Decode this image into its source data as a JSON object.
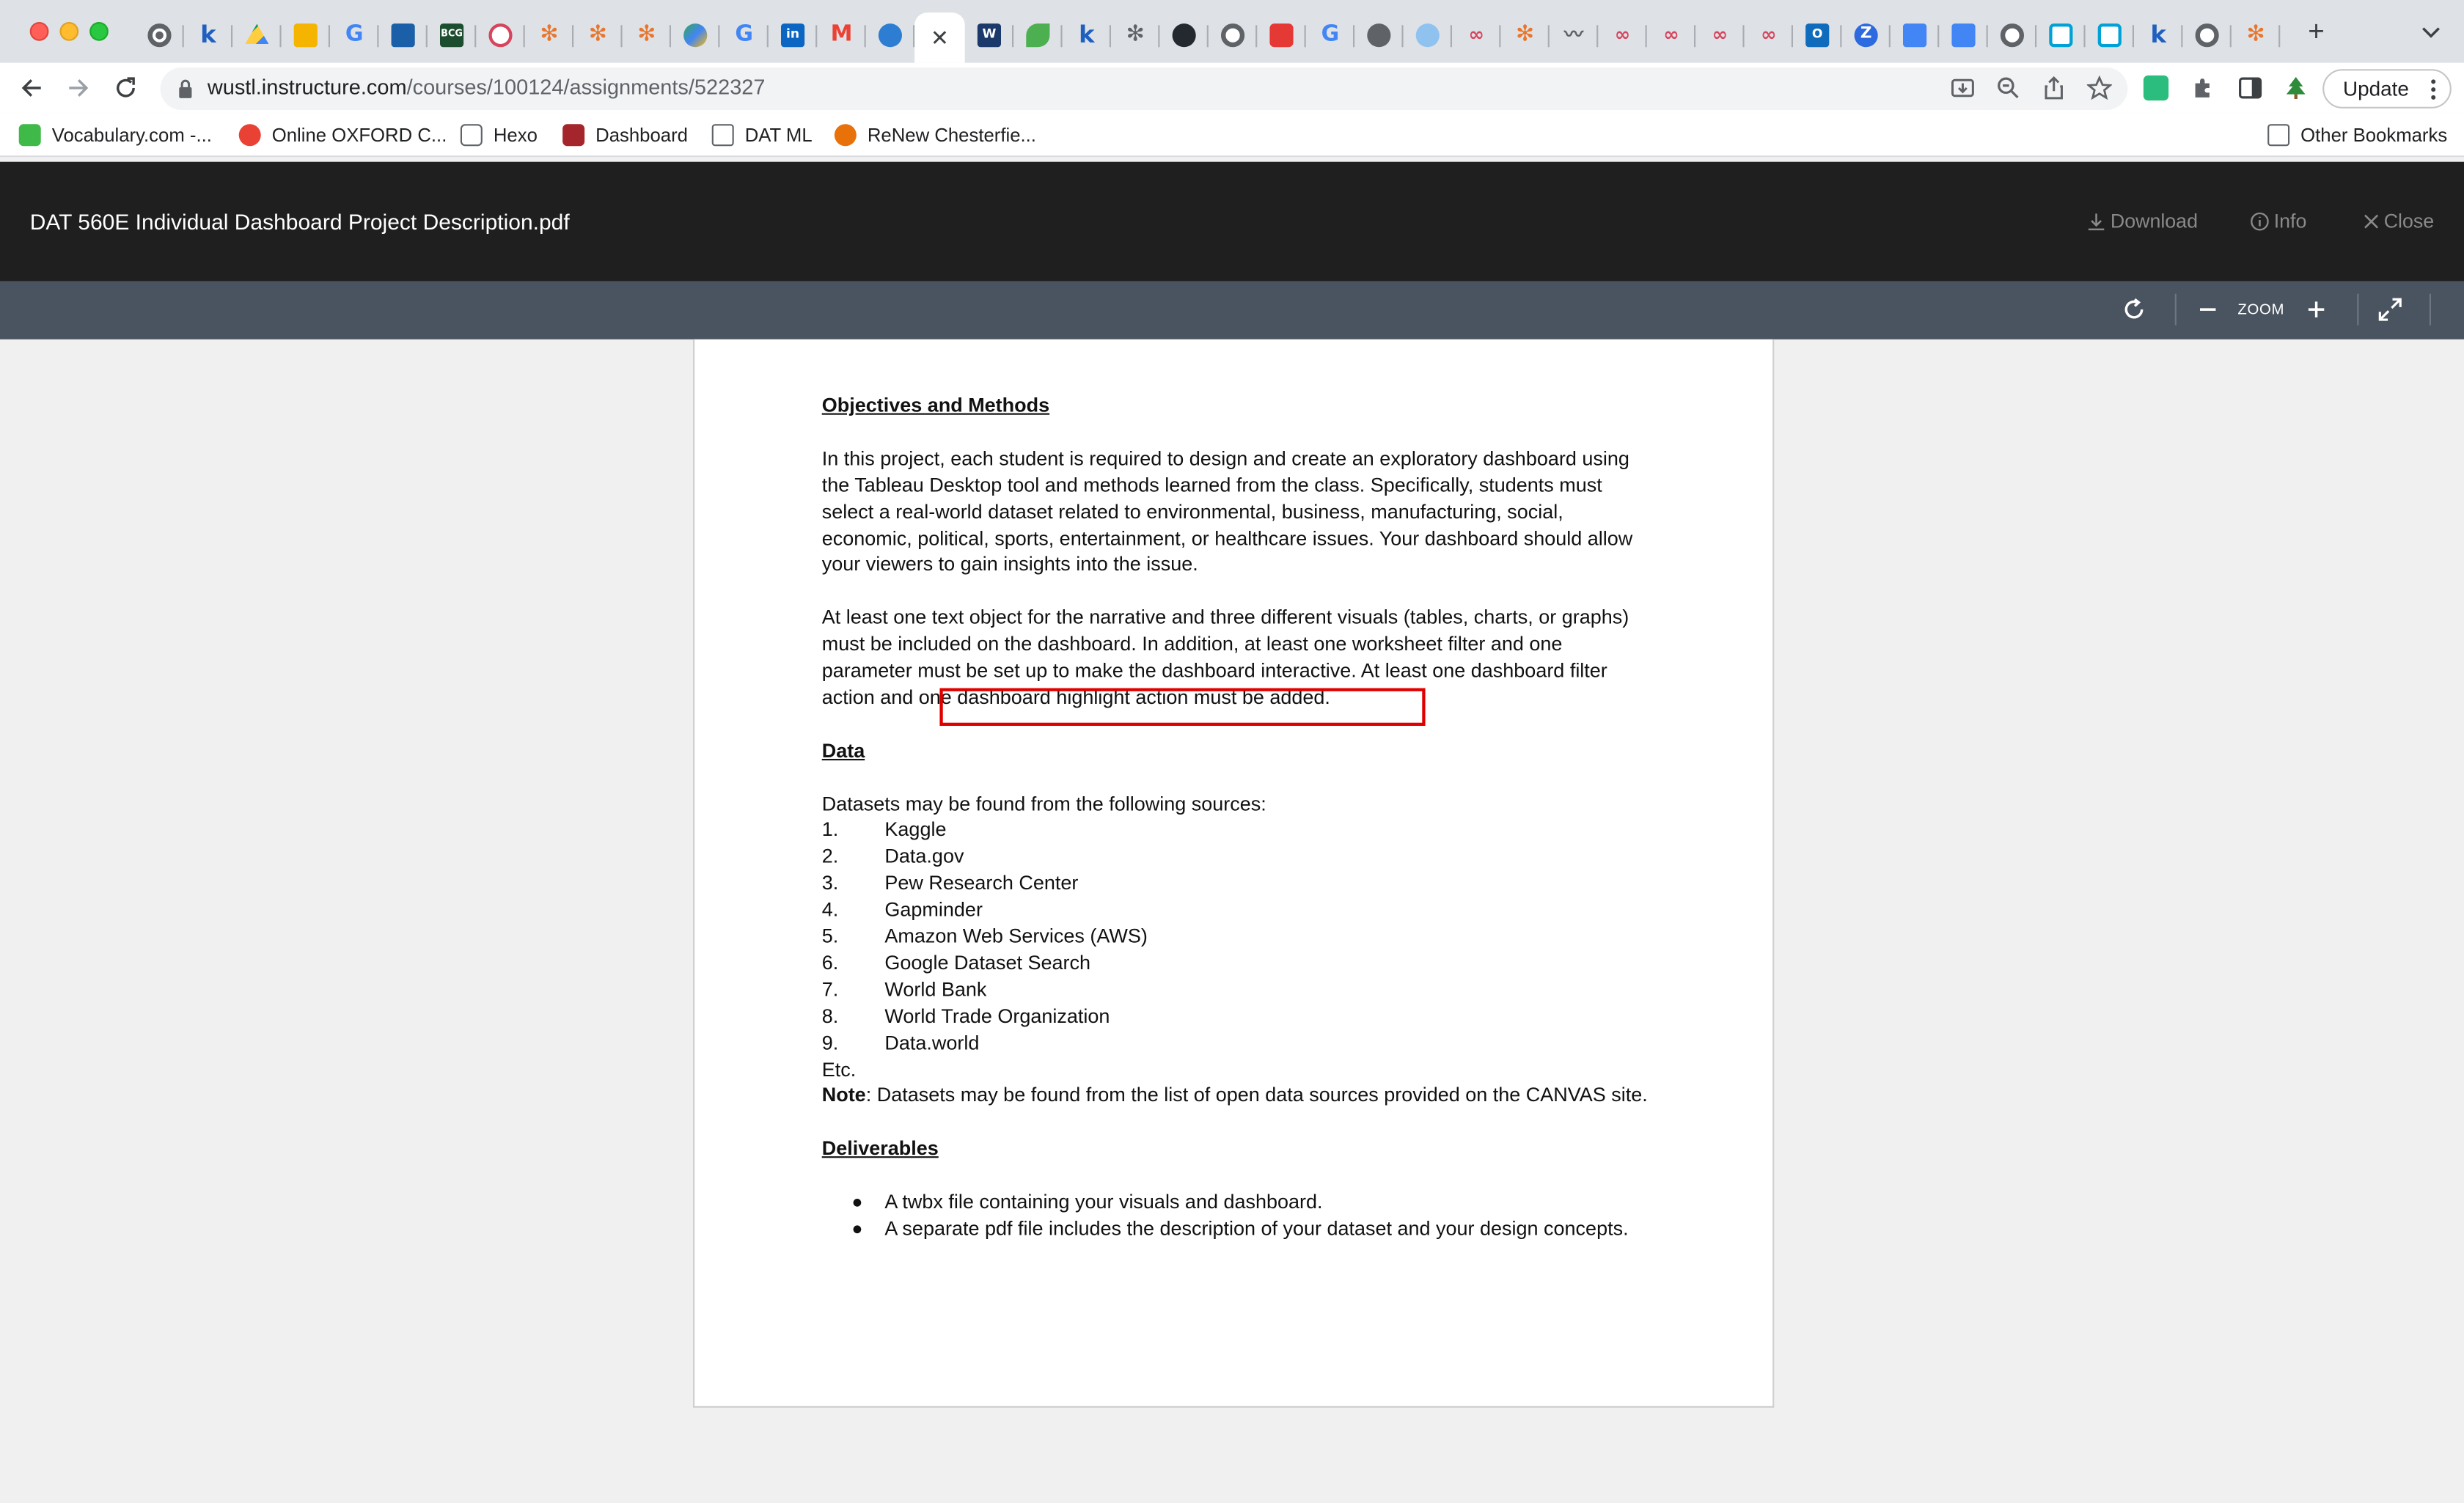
{
  "browser": {
    "tabs_count_label": "",
    "active_tab_close": "✕",
    "new_tab": "+",
    "url_host": "wustl.instructure.com",
    "url_path": "/courses/100124/assignments/522327",
    "update_label": "Update",
    "bookmarks": [
      {
        "label": "Vocabulary.com -...",
        "color": "#3fb948"
      },
      {
        "label": "Online OXFORD C...",
        "color": "#e94235"
      },
      {
        "label": "Hexo",
        "color": "#5f6368"
      },
      {
        "label": "Dashboard",
        "color": "#a4262c"
      },
      {
        "label": "DAT ML",
        "color": "#5f6368"
      },
      {
        "label": "ReNew Chesterfie...",
        "color": "#e8710a"
      }
    ],
    "other_bookmarks": "Other Bookmarks"
  },
  "viewer": {
    "title": "DAT 560E Individual Dashboard Project Description.pdf",
    "download": "Download",
    "info": "Info",
    "close": "Close",
    "zoom": "ZOOM"
  },
  "document": {
    "h_objectives": "Objectives and Methods",
    "p1": "In this project, each student is required to design and create an exploratory dashboard using the Tableau Desktop tool and methods learned from the class. Specifically, students must select a real-world dataset related to environmental, business, manufacturing, social, economic, political, sports, entertainment, or healthcare issues.  Your dashboard should allow your viewers to gain insights into the issue.",
    "p2": "At least one text object for the narrative and three different visuals (tables, charts, or graphs) must be included on the dashboard. In addition, at least one worksheet filter and one parameter must be set up to make the dashboard interactive. At least one dashboard filter action and one dashboard highlight action must be added.",
    "h_data": "Data",
    "data_intro": "Datasets may be found from the following sources:",
    "sources": [
      {
        "num": "1.",
        "name": "Kaggle"
      },
      {
        "num": "2.",
        "name": "Data.gov"
      },
      {
        "num": "3.",
        "name": "Pew Research Center"
      },
      {
        "num": "4.",
        "name": "Gapminder"
      },
      {
        "num": "5.",
        "name": "Amazon Web Services (AWS)"
      },
      {
        "num": "6.",
        "name": "Google Dataset Search"
      },
      {
        "num": "7.",
        "name": "World Bank"
      },
      {
        "num": "8.",
        "name": "World Trade Organization"
      },
      {
        "num": "9.",
        "name": "Data.world"
      }
    ],
    "etc": "Etc.",
    "note_label": "Note",
    "note_text": ": Datasets may be found from the list of open data sources provided on the CANVAS site.",
    "h_deliverables": "Deliverables",
    "deliverables": [
      "A twbx file containing your visuals and dashboard.",
      "A separate pdf file includes the description of your dataset and your design concepts."
    ]
  }
}
